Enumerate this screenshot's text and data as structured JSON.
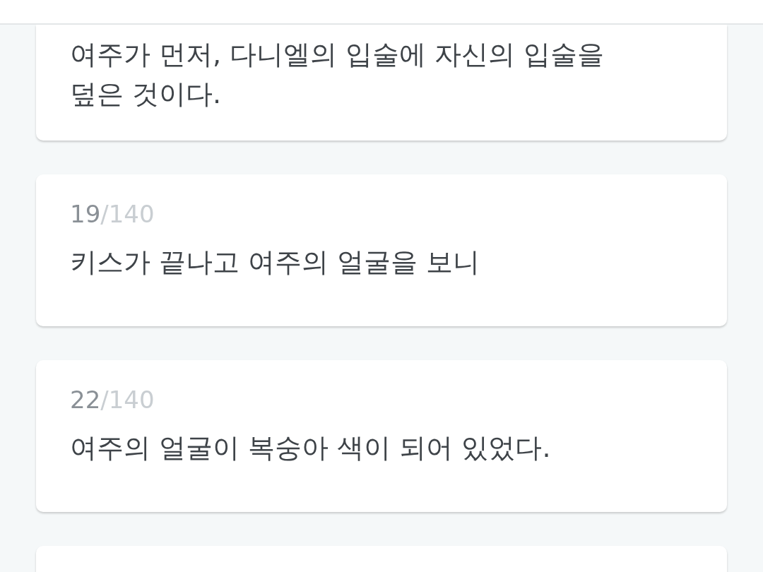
{
  "cards": [
    {
      "text": "여주가 먼저, 다니엘의 입술에 자신의 입술을 덮은 것이다."
    },
    {
      "counter": {
        "index": "19",
        "total": "/140"
      },
      "text": "키스가 끝나고 여주의 얼굴을 보니"
    },
    {
      "counter": {
        "index": "22",
        "total": "/140"
      },
      "text": "여주의 얼굴이 복숭아 색이 되어 있었다."
    }
  ]
}
